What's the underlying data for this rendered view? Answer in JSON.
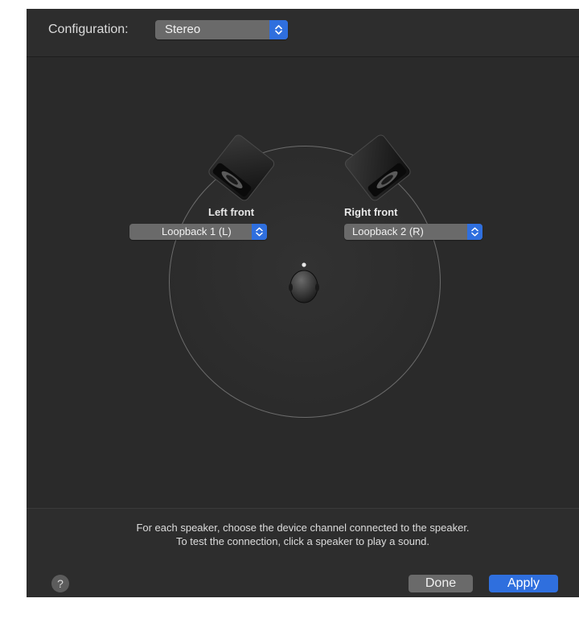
{
  "header": {
    "configuration_label": "Configuration:",
    "configuration_value": "Stereo"
  },
  "speakers": {
    "left": {
      "label": "Left front",
      "channel": "Loopback 1 (L)"
    },
    "right": {
      "label": "Right front",
      "channel": "Loopback 2 (R)"
    }
  },
  "footer": {
    "instruction_line1": "For each speaker, choose the device channel connected to the speaker.",
    "instruction_line2": "To test the connection, click a speaker to play a sound.",
    "help_label": "?",
    "done_label": "Done",
    "apply_label": "Apply"
  },
  "icons": {
    "popup_chevron": "chevron-up-down-icon",
    "speaker": "speaker-icon",
    "listener": "listener-head-icon"
  },
  "colors": {
    "accent": "#2f6fde",
    "window_bg": "#2b2b2b",
    "popup_bg": "#6a6a6a"
  }
}
